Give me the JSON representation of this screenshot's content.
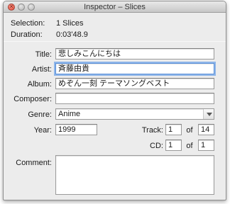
{
  "window": {
    "title": "Inspector – Slices"
  },
  "info": {
    "selection_label": "Selection:",
    "selection_value": "1 Slices",
    "duration_label": "Duration:",
    "duration_value": "0:03'48.9"
  },
  "form": {
    "title_label": "Title:",
    "title_value": "悲しみこんにちは",
    "artist_label": "Artist:",
    "artist_value": "斉藤由貴",
    "album_label": "Album:",
    "album_value": "めぞん一刻 テーマソングベスト",
    "composer_label": "Composer:",
    "composer_value": "",
    "genre_label": "Genre:",
    "genre_value": "Anime",
    "year_label": "Year:",
    "year_value": "1999",
    "track_label": "Track:",
    "track_value": "1",
    "track_of_label": "of",
    "track_total": "14",
    "cd_label": "CD:",
    "cd_value": "1",
    "cd_of_label": "of",
    "cd_total": "1",
    "comment_label": "Comment:",
    "comment_value": ""
  }
}
